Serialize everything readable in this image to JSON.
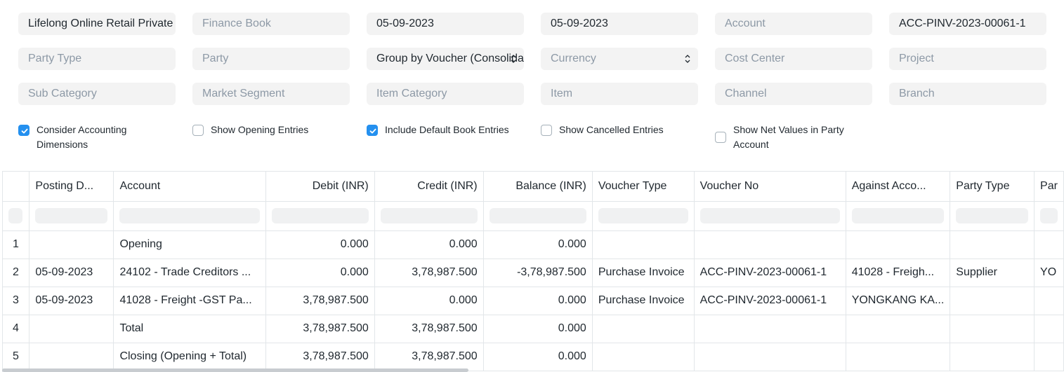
{
  "filters": {
    "company": "Lifelong Online Retail Private Limited",
    "finance_book_placeholder": "Finance Book",
    "from_date": "05-09-2023",
    "to_date": "05-09-2023",
    "account_placeholder": "Account",
    "voucher_no": "ACC-PINV-2023-00061-1",
    "party_type_placeholder": "Party Type",
    "party_placeholder": "Party",
    "group_by": "Group by Voucher (Consolidated)",
    "currency_placeholder": "Currency",
    "cost_center_placeholder": "Cost Center",
    "project_placeholder": "Project",
    "sub_category_placeholder": "Sub Category",
    "market_segment_placeholder": "Market Segment",
    "item_category_placeholder": "Item Category",
    "item_placeholder": "Item",
    "channel_placeholder": "Channel",
    "branch_placeholder": "Branch"
  },
  "checkboxes": [
    {
      "label_line1": "Consider Accounting",
      "label_line2": "Dimensions",
      "checked": true
    },
    {
      "label_line1": "Show Opening Entries",
      "label_line2": "",
      "checked": false
    },
    {
      "label_line1": "Include Default Book Entries",
      "label_line2": "",
      "checked": true
    },
    {
      "label_line1": "Show Cancelled Entries",
      "label_line2": "",
      "checked": false
    },
    {
      "label_line1": "Show Net Values in Party",
      "label_line2": "Account",
      "checked": false
    }
  ],
  "table": {
    "columns": [
      "Posting D...",
      "Account",
      "Debit (INR)",
      "Credit (INR)",
      "Balance (INR)",
      "Voucher Type",
      "Voucher No",
      "Against Acco...",
      "Party Type",
      "Par"
    ],
    "rows": [
      {
        "idx": "1",
        "date": "",
        "account": "Opening",
        "debit": "0.000",
        "credit": "0.000",
        "balance": "0.000",
        "voucher_type": "",
        "voucher_no": "",
        "against": "",
        "party_type": "",
        "party": ""
      },
      {
        "idx": "2",
        "date": "05-09-2023",
        "account": "24102 - Trade Creditors ...",
        "debit": "0.000",
        "credit": "3,78,987.500",
        "balance": "-3,78,987.500",
        "voucher_type": "Purchase Invoice",
        "voucher_no": "ACC-PINV-2023-00061-1",
        "against": "41028 - Freigh...",
        "party_type": "Supplier",
        "party": "YO"
      },
      {
        "idx": "3",
        "date": "05-09-2023",
        "account": "41028 - Freight -GST Pa...",
        "debit": "3,78,987.500",
        "credit": "0.000",
        "balance": "0.000",
        "voucher_type": "Purchase Invoice",
        "voucher_no": "ACC-PINV-2023-00061-1",
        "against": "YONGKANG KA...",
        "party_type": "",
        "party": ""
      },
      {
        "idx": "4",
        "date": "",
        "account": "Total",
        "debit": "3,78,987.500",
        "credit": "3,78,987.500",
        "balance": "0.000",
        "voucher_type": "",
        "voucher_no": "",
        "against": "",
        "party_type": "",
        "party": ""
      },
      {
        "idx": "5",
        "date": "",
        "account": "Closing (Opening + Total)",
        "debit": "3,78,987.500",
        "credit": "3,78,987.500",
        "balance": "0.000",
        "voucher_type": "",
        "voucher_no": "",
        "against": "",
        "party_type": "",
        "party": ""
      }
    ]
  },
  "colors": {
    "accent": "#2490ef",
    "field_bg": "#f3f3f3",
    "placeholder": "#8d99a6",
    "border": "#e2e6e9"
  }
}
